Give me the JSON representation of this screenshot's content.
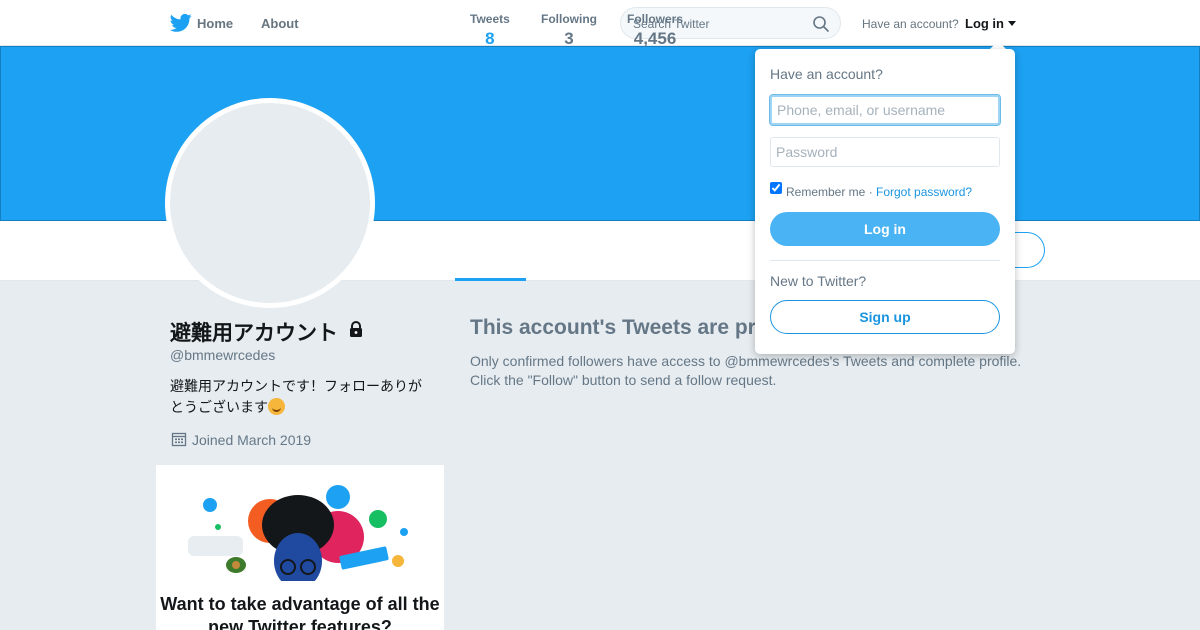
{
  "nav": {
    "home_label": "Home",
    "about_label": "About",
    "search_placeholder": "Search Twitter",
    "have_account": "Have an account?",
    "login_label": "Log in"
  },
  "profile": {
    "name": "避難用アカウント",
    "handle": "@bmmewrcedes",
    "bio": "避難用アカウントです！フォローありがとうございます",
    "joined": "Joined March 2019",
    "stats": [
      {
        "label": "Tweets",
        "value": "8"
      },
      {
        "label": "Following",
        "value": "3"
      },
      {
        "label": "Followers",
        "value": "4,456"
      }
    ]
  },
  "protected": {
    "title": "This account's Tweets are pr",
    "line1": "Only confirmed followers have access to @bmmewrcedes's Tweets and complete profile.",
    "line2": "Click the \"Follow\" button to send a follow request."
  },
  "promo": {
    "title": "Want to take advantage of all the new Twitter features?"
  },
  "login_dropdown": {
    "heading": "Have an account?",
    "username_placeholder": "Phone, email, or username",
    "password_placeholder": "Password",
    "remember_label": "Remember me ·",
    "forgot_label": "Forgot password?",
    "login_button": "Log in",
    "new_label": "New to Twitter?",
    "signup_button": "Sign up"
  },
  "colors": {
    "accent": "#1da1f2",
    "banner": "#1da1f2",
    "background": "#e6ecf0"
  }
}
